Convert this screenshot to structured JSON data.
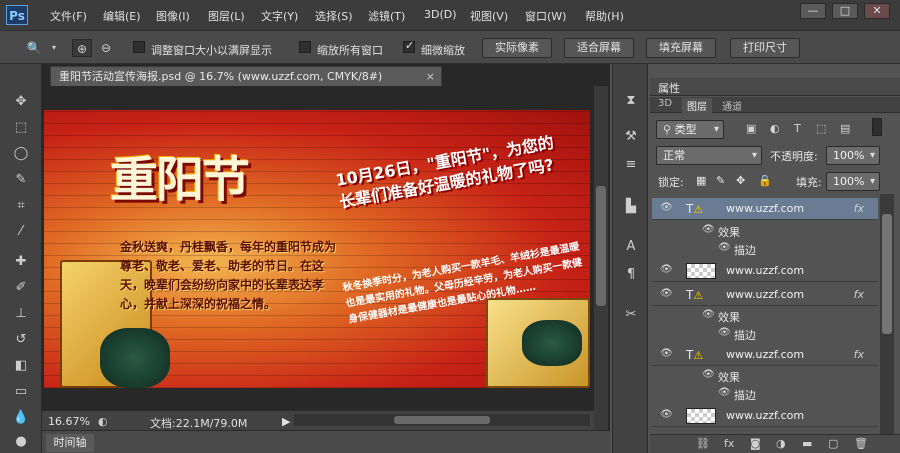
{
  "app": {
    "logo": "Ps"
  },
  "menu": [
    "文件(F)",
    "编辑(E)",
    "图像(I)",
    "图层(L)",
    "文字(Y)",
    "选择(S)",
    "滤镜(T)",
    "3D(D)",
    "视图(V)",
    "窗口(W)",
    "帮助(H)"
  ],
  "window_controls": {
    "minimize": "—",
    "maximize": "□",
    "close": "✕"
  },
  "options": {
    "resize_windows": "调整窗口大小以满屏显示",
    "zoom_all": "缩放所有窗口",
    "scrubby_zoom": "细微缩放",
    "btn_actual": "实际像素",
    "btn_fit": "适合屏幕",
    "btn_fill": "填充屏幕",
    "btn_print": "打印尺寸",
    "resize_checked": false,
    "zoom_all_checked": false,
    "scrubby_checked": true
  },
  "document": {
    "tab_title": "重阳节活动宣传海报.psd @ 16.7% (www.uzzf.com, CMYK/8#)",
    "tab_close": "×",
    "zoom": "16.67%",
    "doc_info": "文档:22.1M/79.0M",
    "timeline_tab": "时间轴"
  },
  "poster": {
    "title": "重阳节",
    "para1": "金秋送爽，丹桂飘香，每年的重阳节成为尊老、敬老、爱老、助老的节日。在这天，晚辈们会纷纷向家中的长辈表达孝心，并献上深深的祝福之情。",
    "headline": "10月26日，\"重阳节\"，为您的长辈们准备好温暖的礼物了吗?",
    "para2": "秋冬换季时分，为老人购买一款羊毛、羊绒衫是最温暖也是最实用的礼物。父母历经辛劳，为老人购买一款健身保健器材是最健康也是最贴心的礼物……"
  },
  "panel": {
    "header": "属性",
    "tabs": [
      "3D",
      "图层",
      "通道"
    ],
    "active_tab": "图层",
    "filter_type": "类型",
    "blend_mode": "正常",
    "opacity_label": "不透明度:",
    "opacity_value": "100%",
    "lock_label": "锁定:",
    "fill_label": "填充:",
    "fill_value": "100%",
    "layers": [
      {
        "name": "www.uzzf.com",
        "kind": "text",
        "fx": "fx",
        "selected": true
      },
      {
        "sub": "效果"
      },
      {
        "sub": "描边"
      },
      {
        "name": "www.uzzf.com",
        "kind": "raster",
        "fx": "",
        "selected": false
      },
      {
        "name": "www.uzzf.com",
        "kind": "text",
        "fx": "fx",
        "selected": false
      },
      {
        "sub": "效果"
      },
      {
        "sub": "描边"
      },
      {
        "name": "www.uzzf.com",
        "kind": "text",
        "fx": "fx",
        "selected": false
      },
      {
        "sub": "效果"
      },
      {
        "sub": "描边"
      },
      {
        "name": "www.uzzf.com",
        "kind": "raster",
        "fx": "",
        "selected": false
      }
    ]
  },
  "colors": {
    "menubar": "#3c3c3c",
    "selected_layer": "#6a7b94",
    "warning": "#f6d000"
  }
}
